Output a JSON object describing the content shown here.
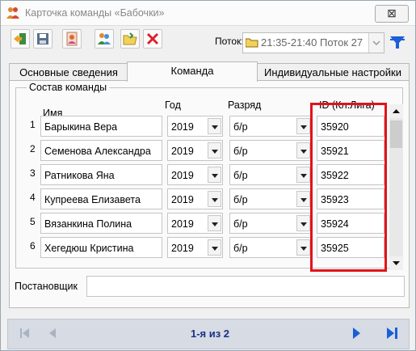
{
  "window": {
    "title": "Карточка команды «Бабочки»",
    "close_symbol": "⊠",
    "icon": "team-icon"
  },
  "toolbar": {
    "buttons": [
      {
        "name": "exit-icon"
      },
      {
        "name": "save-icon"
      },
      {
        "name": "person-card-icon"
      },
      {
        "name": "people-icon"
      },
      {
        "name": "folder-open-icon"
      },
      {
        "name": "delete-icon"
      }
    ],
    "potok_label": "Поток:",
    "potok_value": "21:35-21:40 Поток 27",
    "filter_icon": "filter-icon"
  },
  "tabs": [
    {
      "label": "Основные сведения",
      "active": false
    },
    {
      "label": "Команда",
      "active": true
    },
    {
      "label": "Индивидуальные настройки",
      "active": false
    }
  ],
  "team": {
    "group_title": "Состав команды",
    "headers": {
      "name": "Имя",
      "year": "Год",
      "rank": "Разряд",
      "id": "ID (Кл.Лига)"
    },
    "rows": [
      {
        "num": "1",
        "name": "Барыкина Вера",
        "year": "2019",
        "rank": "б/р",
        "id": "35920"
      },
      {
        "num": "2",
        "name": "Семенова Александра",
        "year": "2019",
        "rank": "б/р",
        "id": "35921"
      },
      {
        "num": "3",
        "name": "Ратникова Яна",
        "year": "2019",
        "rank": "б/р",
        "id": "35922"
      },
      {
        "num": "4",
        "name": "Купреева Елизавета",
        "year": "2019",
        "rank": "б/р",
        "id": "35923"
      },
      {
        "num": "5",
        "name": "Вязанкина Полина",
        "year": "2019",
        "rank": "б/р",
        "id": "35924"
      },
      {
        "num": "6",
        "name": "Хегедюш Кристина",
        "year": "2019",
        "rank": "б/р",
        "id": "35925"
      }
    ]
  },
  "choreographer": {
    "label": "Постановщик",
    "value": ""
  },
  "navigation": {
    "page_info": "1-я из 2"
  },
  "colors": {
    "highlight": "#e2131b",
    "nav_blue": "#1a5fd6",
    "page_text": "#1b2f86"
  }
}
